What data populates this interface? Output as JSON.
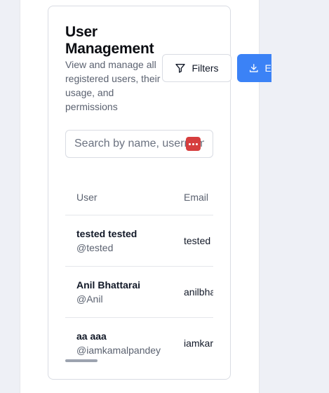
{
  "header": {
    "title": "User Management",
    "description": "View and manage all registered users, their usage, and permissions"
  },
  "toolbar": {
    "filters_label": "Filters",
    "export_label": "Export"
  },
  "search": {
    "placeholder": "Search by name, username or email"
  },
  "table": {
    "columns": [
      "User",
      "Email"
    ],
    "rows": [
      {
        "name": "tested tested",
        "username": "@tested",
        "email": "tested"
      },
      {
        "name": "Anil Bhattarai",
        "username": "@Anil",
        "email": "anilbha"
      },
      {
        "name": "aa aaa",
        "username": "@iamkamalpandey",
        "email": "iamkar"
      }
    ]
  },
  "icons": {
    "filter": "filter-icon",
    "download": "download-icon",
    "more": "more-icon"
  },
  "colors": {
    "primary": "#3b82f6",
    "badge": "#d63e3e",
    "background": "#eef0f6"
  }
}
